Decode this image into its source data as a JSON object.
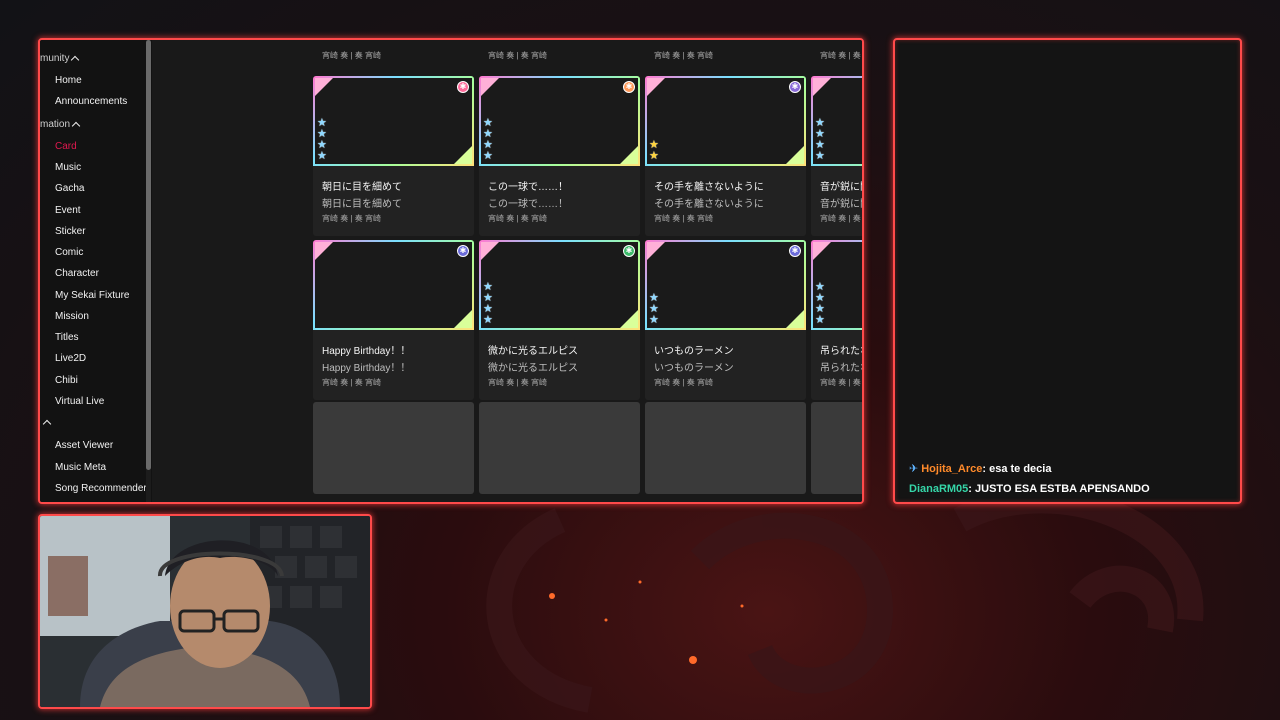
{
  "sidebar": {
    "sections": [
      {
        "label": "munity"
      },
      {
        "label": "mation"
      }
    ],
    "community_items": [
      "Home",
      "Announcements"
    ],
    "info_items": [
      "Card",
      "Music",
      "Gacha",
      "Event",
      "Sticker",
      "Comic",
      "Character",
      "My Sekai Fixture",
      "Mission",
      "Titles",
      "Live2D",
      "Chibi",
      "Virtual Live"
    ],
    "tool_items": [
      "Asset Viewer",
      "Music Meta",
      "Song Recommender"
    ],
    "active_item": "Card"
  },
  "cards": {
    "top_row_artist": [
      "宵崎 奏 | 奏 宵崎",
      "宵崎 奏 | 奏 宵崎",
      "宵崎 奏 | 奏 宵崎",
      "宵崎 奏 | 奏 宵崎"
    ],
    "row1": [
      {
        "title": "朝日に目を細めて",
        "subtitle": "朝日に目を細めて",
        "artist": "宵崎 奏 | 奏 宵崎",
        "attr_color": "#ff6b9a",
        "attr_icon": "flower-icon",
        "stars": 4,
        "star_type": "blue"
      },
      {
        "title": "この一球で……！",
        "subtitle": "この一球で……！",
        "artist": "宵崎 奏 | 奏 宵崎",
        "attr_color": "#ff9a5a",
        "attr_icon": "heart-icon",
        "stars": 4,
        "star_type": "blue"
      },
      {
        "title": "その手を離さないように",
        "subtitle": "その手を離さないように",
        "artist": "宵崎 奏 | 奏 宵崎",
        "attr_color": "#8a6bd9",
        "attr_icon": "moon-icon",
        "stars": 2,
        "star_type": "gold"
      },
      {
        "title": "音が鋭に聞",
        "subtitle": "音が鋭に聞",
        "artist": "宵崎 奏 | 奏 宵崎",
        "attr_color": "#ff6b9a",
        "attr_icon": "flower-icon",
        "stars": 4,
        "star_type": "blue"
      }
    ],
    "row2": [
      {
        "title": "Happy Birthday！！",
        "subtitle": "Happy Birthday！！",
        "artist": "宵崎 奏 | 奏 宵崎",
        "attr_color": "#6b6bd9",
        "attr_icon": "star-burst-icon",
        "stars": 0,
        "star_type": "blue"
      },
      {
        "title": "微かに光るエルピス",
        "subtitle": "微かに光るエルピス",
        "artist": "宵崎 奏 | 奏 宵崎",
        "attr_color": "#3dbb6b",
        "attr_icon": "leaf-icon",
        "stars": 4,
        "star_type": "blue"
      },
      {
        "title": "いつものラーメン",
        "subtitle": "いつものラーメン",
        "artist": "宵崎 奏 | 奏 宵崎",
        "attr_color": "#6b6bd9",
        "attr_icon": "star-burst-icon",
        "stars": 3,
        "star_type": "blue"
      },
      {
        "title": "吊られたな",
        "subtitle": "吊られたな",
        "artist": "宵崎 奏 | 奏 宵崎",
        "attr_color": "#ff6b9a",
        "attr_icon": "flower-icon",
        "stars": 4,
        "star_type": "blue"
      }
    ]
  },
  "chat": {
    "messages": [
      {
        "user": "Hojita_Arce",
        "user_color": "#ff8a2a",
        "badge_icon": "pin-icon",
        "text": "esa te decia"
      },
      {
        "user": "DianaRM05",
        "user_color": "#35d6a8",
        "badge_icon": "",
        "text": "JUSTO ESA ESTBA APENSANDO"
      }
    ]
  },
  "colors": {
    "frame_border": "#ff4a4a",
    "active_sidebar": "#e0194f"
  }
}
